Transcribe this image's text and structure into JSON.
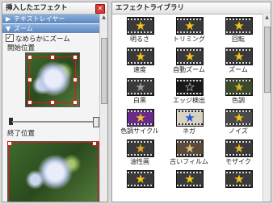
{
  "left_panel": {
    "title": "挿入したエフェクト",
    "close_icon": "close-icon",
    "sections": [
      {
        "label": "テキストレイヤー",
        "expanded": false
      },
      {
        "label": "ズーム",
        "expanded": true
      }
    ],
    "smooth_zoom_label": "なめらかにズーム",
    "start_label": "開始位置",
    "end_label": "終了位置"
  },
  "right_panel": {
    "title": "エフェクトライブラリ",
    "effects": [
      {
        "label": "明るさ",
        "icon": "star",
        "color": "#f3c21a",
        "bg": "#3a3a3a"
      },
      {
        "label": "トリミング",
        "icon": "star",
        "color": "#f3c21a",
        "bg": "#3a3a3a"
      },
      {
        "label": "回転",
        "icon": "star",
        "color": "#f3c21a",
        "bg": "#3a3a3a"
      },
      {
        "label": "速度",
        "icon": "star",
        "color": "#f3c21a",
        "bg": "#3a3a3a"
      },
      {
        "label": "自動ズーム",
        "icon": "star",
        "color": "#f3c21a",
        "bg": "#3a3a3a"
      },
      {
        "label": "ズーム",
        "icon": "star",
        "color": "#f3c21a",
        "bg": "#3a3a3a"
      },
      {
        "label": "白黒",
        "icon": "star",
        "color": "#9a9a9a",
        "bg": "#3a3a3a"
      },
      {
        "label": "エッジ検出",
        "icon": "star-outline",
        "color": "#ffffff",
        "bg": "#1a1a1a"
      },
      {
        "label": "色調",
        "icon": "star",
        "color": "#d7b52a",
        "bg": "#3a4a2a"
      },
      {
        "label": "色調サイクル",
        "icon": "star",
        "color": "#f3c21a",
        "bg": "#6a2a8a"
      },
      {
        "label": "ネガ",
        "icon": "star",
        "color": "#2a56d8",
        "bg": "#d8d2c2"
      },
      {
        "label": "ノイズ",
        "icon": "star",
        "color": "#f3c21a",
        "bg": "#4a4a4a"
      },
      {
        "label": "油性画",
        "icon": "star",
        "color": "#e0a81a",
        "bg": "#3a3a3a"
      },
      {
        "label": "古いフィルム",
        "icon": "star",
        "color": "#d8c07a",
        "bg": "#5a4a3a"
      },
      {
        "label": "モザイク",
        "icon": "star",
        "color": "#e6b820",
        "bg": "#3a3a3a"
      },
      {
        "label": "",
        "icon": "star",
        "color": "#f3c21a",
        "bg": "#3a3a3a"
      },
      {
        "label": "",
        "icon": "star",
        "color": "#f3c21a",
        "bg": "#3a3a3a"
      },
      {
        "label": "",
        "icon": "star",
        "color": "#f3c21a",
        "bg": "#3a3a3a"
      }
    ]
  }
}
